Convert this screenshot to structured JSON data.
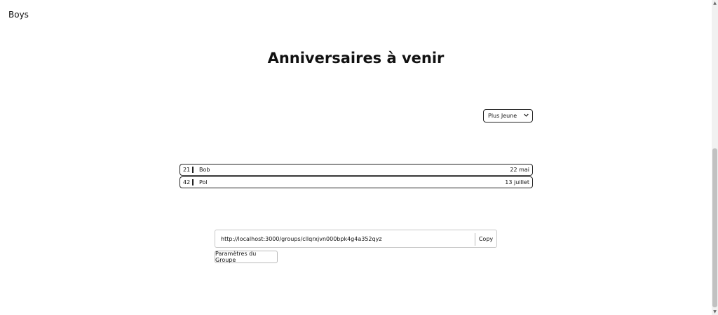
{
  "header": {
    "group_name": "Boys"
  },
  "main": {
    "title": "Anniversaires à venir",
    "sort": {
      "selected": "Plus Jeune"
    },
    "birthdays": [
      {
        "age": "21",
        "name": "Bob",
        "date": "22 mai"
      },
      {
        "age": "42",
        "name": "Pol",
        "date": "13 juillet"
      }
    ]
  },
  "share": {
    "url": "http://localhost:3000/groups/cllqrxjvn000bpk4g4a352qyz",
    "copy_label": "Copy"
  },
  "settings": {
    "label": "Paramètres du Groupe"
  },
  "icons": {
    "select_chevron": "chevron-down-icon"
  }
}
